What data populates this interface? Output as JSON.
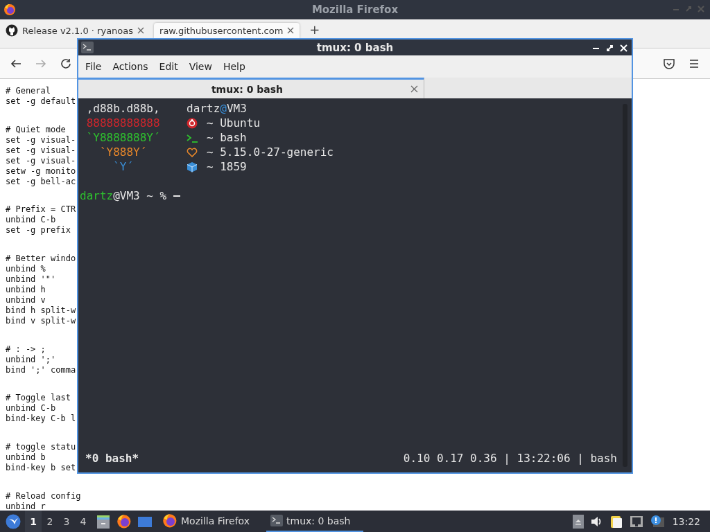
{
  "firefox": {
    "title": "Mozilla Firefox",
    "tabs": [
      {
        "label": "Release v2.1.0 · ryanoas",
        "selected": false
      },
      {
        "label": "raw.githubusercontent.com",
        "selected": true
      }
    ],
    "new_tab": "+",
    "page_blocks": [
      {
        "lines": [
          "# General",
          "set -g default"
        ]
      },
      {
        "lines": [
          "# Quiet mode",
          "set -g visual-",
          "set -g visual-",
          "set -g visual-",
          "setw -g monito",
          "set -g bell-ac"
        ]
      },
      {
        "lines": [
          "# Prefix = CTR",
          "unbind C-b",
          "set -g prefix"
        ]
      },
      {
        "lines": [
          "# Better windo",
          "unbind %",
          "unbind '\"'",
          "unbind h",
          "unbind v",
          "bind h split-w",
          "bind v split-w"
        ]
      },
      {
        "lines": [
          "# : -> ;",
          "unbind ';'",
          "bind ';' comma"
        ]
      },
      {
        "lines": [
          "# Toggle last",
          "unbind C-b",
          "bind-key C-b l"
        ]
      },
      {
        "lines": [
          "# toggle statu",
          "unbind b",
          "bind-key b set"
        ]
      },
      {
        "lines": [
          "# Reload config",
          "unbind r"
        ]
      }
    ]
  },
  "terminal": {
    "title": "tmux: 0 bash",
    "menu": [
      "File",
      "Actions",
      "Edit",
      "View",
      "Help"
    ],
    "tabs": [
      {
        "label": "tmux: 0 bash",
        "selected": true
      }
    ],
    "art": [
      {
        "text": ",d88b.d88b,",
        "color": "#e6e6e6"
      },
      {
        "text": "88888888888",
        "color": "#d0262c"
      },
      {
        "text": "`Y8888888Y´",
        "color": "#2ec22e"
      },
      {
        "text": "`Y888Y´",
        "color": "#e8872a"
      },
      {
        "text": "`Y´",
        "color": "#3a8fd8"
      }
    ],
    "user": "dartz",
    "at": "@",
    "host": "VM3",
    "info": [
      {
        "color": "#d0262c",
        "text": "~ Ubuntu"
      },
      {
        "color": "#2ec22e",
        "text": "~ bash"
      },
      {
        "color": "#e8872a",
        "text": "~ 5.15.0-27-generic"
      },
      {
        "color": "#3a8fd8",
        "text": "~ 1859"
      }
    ],
    "prompt": {
      "user": "dartz",
      "rest": "@VM3 ~ %"
    },
    "status": {
      "left": "*0 bash*",
      "right": "0.10 0.17 0.36 | 13:22:06 | bash"
    }
  },
  "taskbar": {
    "workspaces": [
      {
        "label": "1",
        "selected": true
      },
      {
        "label": "2",
        "selected": false
      },
      {
        "label": "3",
        "selected": false
      },
      {
        "label": "4",
        "selected": false
      }
    ],
    "tasks": [
      {
        "label": "Mozilla Firefox",
        "selected": false
      },
      {
        "label": "tmux: 0 bash",
        "selected": true
      }
    ],
    "clock": "13:22"
  }
}
